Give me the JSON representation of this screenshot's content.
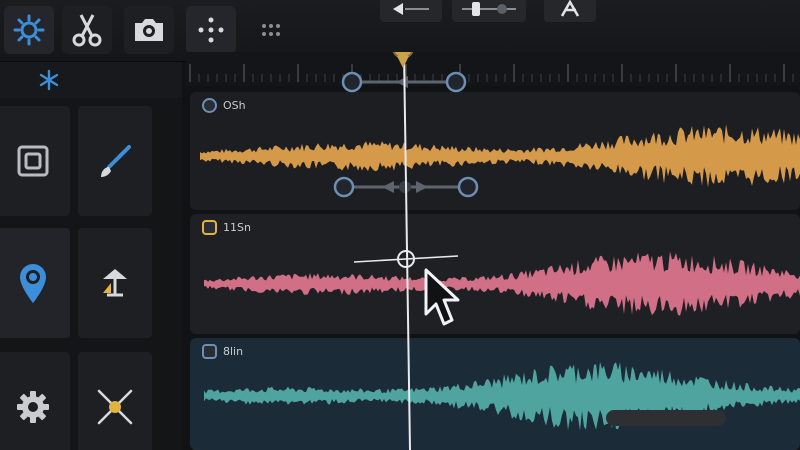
{
  "toolbar": {
    "tools": [
      {
        "name": "clock-tool",
        "icon": "sun-gear-icon",
        "active": true
      },
      {
        "name": "scissors-tool",
        "icon": "scissors-icon",
        "active": false
      },
      {
        "name": "snapshot-tool",
        "icon": "camera-icon",
        "active": false
      },
      {
        "name": "grid-tool",
        "icon": "dots-grid-icon",
        "active": true
      },
      {
        "name": "dots-tool",
        "icon": "dots-icon",
        "active": false
      }
    ],
    "top_controls": [
      "volume-slider-icon",
      "fader-icon",
      "mixer-icon",
      "logo-icon"
    ]
  },
  "left_panel": {
    "sub_icon": "asterisk-icon",
    "tools": [
      {
        "icon": "frame-icon"
      },
      {
        "icon": "brush-icon"
      },
      {
        "icon": "location-pin-icon",
        "selected": true
      },
      {
        "icon": "flag-icon"
      },
      {
        "icon": "gear-icon"
      },
      {
        "icon": "crossfade-icon"
      }
    ]
  },
  "tracks": [
    {
      "label": "OSh",
      "color": "#d49a4a",
      "bg": "#1d1e21"
    },
    {
      "label": "11Sn",
      "color": "#d06f86",
      "bg": "#1f2023"
    },
    {
      "label": "8lin",
      "color": "#4fa4a0",
      "bg": "#1b2b38"
    }
  ],
  "colors": {
    "accent_blue": "#3d8ed8",
    "handle": "#6d8fb5",
    "playhead": "#e8eaec",
    "marker": "#c9a24a"
  }
}
